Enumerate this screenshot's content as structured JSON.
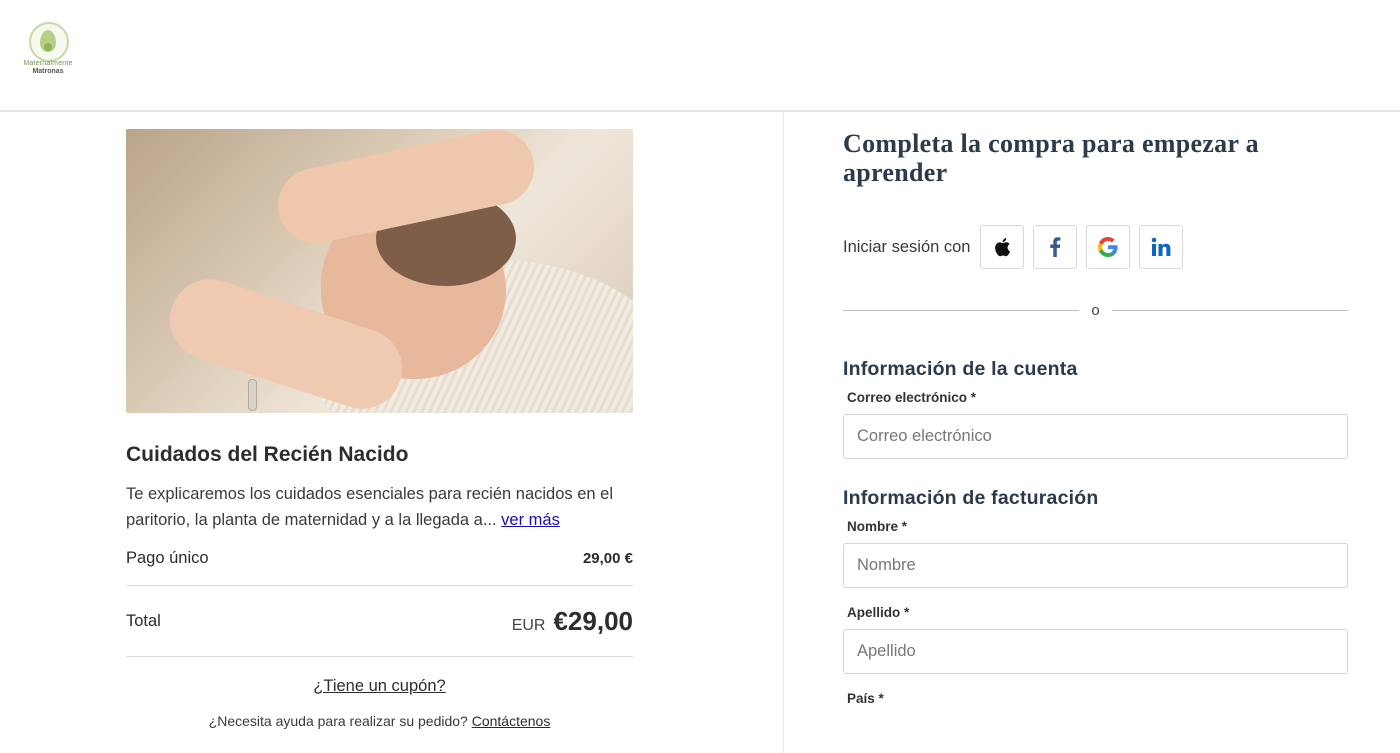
{
  "header": {
    "logo_line1": "Maternalmente",
    "logo_line2": "Matronas"
  },
  "product": {
    "image_alt": "Recién nacido durmiendo",
    "title": "Cuidados del Recién Nacido",
    "description": "Te explicaremos los cuidados esenciales para recién nacidos en el paritorio, la planta de maternidad y a la llegada a...",
    "see_more": "ver más",
    "payment_label": "Pago único",
    "payment_price": "29,00 €",
    "total_label": "Total",
    "total_currency": "EUR",
    "total_amount": "€29,00",
    "coupon_link": "¿Tiene un cupón?",
    "help_text": "¿Necesita ayuda para realizar su pedido?",
    "help_link": "Contáctenos"
  },
  "checkout": {
    "title": "Completa la compra para empezar a aprender",
    "signin_label": "Iniciar sesión con",
    "social": [
      "apple-icon",
      "facebook-icon",
      "google-icon",
      "linkedin-icon"
    ],
    "or_text": "o",
    "account_section": "Información de la cuenta",
    "email_label": "Correo electrónico *",
    "email_placeholder": "Correo electrónico",
    "billing_section": "Información de facturación",
    "first_name_label": "Nombre *",
    "first_name_placeholder": "Nombre",
    "last_name_label": "Apellido *",
    "last_name_placeholder": "Apellido",
    "country_label": "País *"
  },
  "colors": {
    "accent_link": "#1a0dab",
    "heading": "#2d3a4a",
    "border": "#d4d4d4",
    "facebook": "#3b5998",
    "linkedin": "#0a66c2"
  }
}
